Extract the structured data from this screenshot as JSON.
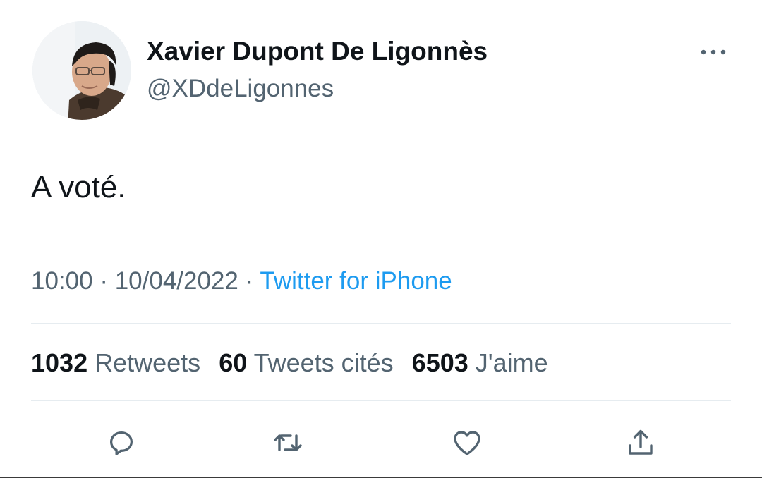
{
  "tweet": {
    "author": {
      "display_name": "Xavier Dupont De Ligonnès",
      "handle": "@XDdeLigonnes"
    },
    "text": "A voté.",
    "time": "10:00",
    "date": "10/04/2022",
    "separator": "·",
    "source": "Twitter for iPhone"
  },
  "stats": {
    "retweets": {
      "count": "1032",
      "label": "Retweets"
    },
    "quotes": {
      "count": "60",
      "label": "Tweets cités"
    },
    "likes": {
      "count": "6503",
      "label": "J'aime"
    }
  },
  "actions": [
    "reply-icon",
    "retweet-icon",
    "like-icon",
    "share-icon"
  ],
  "colors": {
    "text_primary": "#0f1419",
    "text_secondary": "#536471",
    "link": "#1d9bf0",
    "divider": "#e6ecf0"
  }
}
